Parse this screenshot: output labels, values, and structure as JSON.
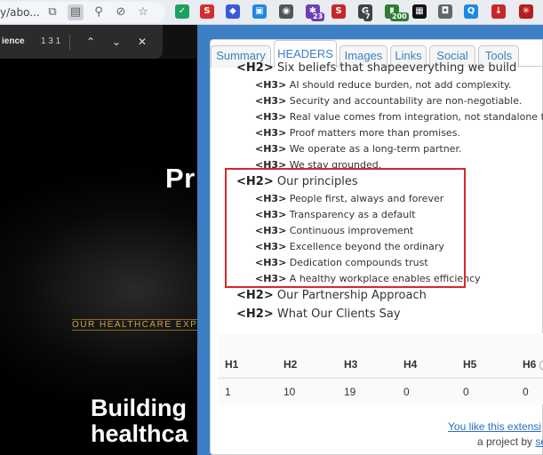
{
  "browser": {
    "url_fragment": "y/abo...",
    "extensions": [
      {
        "name": "shield-check-ext",
        "color": "#1aa260",
        "glyph": "✓"
      },
      {
        "name": "seo-ext",
        "color": "#d32f2f",
        "glyph": "S"
      },
      {
        "name": "tag-ext",
        "color": "#3a5bd9",
        "glyph": "◆"
      },
      {
        "name": "square-ext",
        "color": "#1e88e5",
        "glyph": "▣"
      },
      {
        "name": "location-ext",
        "color": "#555555",
        "glyph": "◉"
      },
      {
        "name": "puzzle-ext",
        "color": "#6a3fb5",
        "glyph": "✱",
        "badge": "23",
        "badge_color": "#6a3fb5"
      },
      {
        "name": "s-ext",
        "color": "#c62828",
        "glyph": "S"
      },
      {
        "name": "g-ext",
        "color": "#424242",
        "glyph": "G",
        "badge": "7",
        "badge_color": "#424242"
      },
      {
        "name": "chart-ext",
        "color": "#2e7d32",
        "glyph": "▮",
        "badge": "200",
        "badge_color": "#2e7d32"
      },
      {
        "name": "qr-ext",
        "color": "#111111",
        "glyph": "▦"
      },
      {
        "name": "camera-ext",
        "color": "#666666",
        "glyph": "◘"
      },
      {
        "name": "q-ext",
        "color": "#1e88e5",
        "glyph": "Q"
      },
      {
        "name": "down-ext",
        "color": "#c62828",
        "glyph": "↓"
      },
      {
        "name": "spider-ext",
        "color": "#b71c1c",
        "glyph": "✳"
      }
    ]
  },
  "findbar": {
    "query": "ience",
    "count": "1 3 1"
  },
  "page": {
    "hero_pr": "Pr",
    "hero_exp": "OUR HEALTHCARE EXPERIE",
    "hero_line1": "Building",
    "hero_line2": "healthca"
  },
  "popup": {
    "tabs": [
      "Summary",
      "HEADERS",
      "Images",
      "Links",
      "Social",
      "Tools"
    ],
    "active_tab": "HEADERS",
    "tree": [
      {
        "level": "H2",
        "tag": "<H2>",
        "text": "Six beliefs that shapeeverything we build"
      },
      {
        "level": "H3",
        "tag": "<H3>",
        "text": "AI should reduce burden, not add complexity."
      },
      {
        "level": "H3",
        "tag": "<H3>",
        "text": "Security and accountability are non-negotiable."
      },
      {
        "level": "H3",
        "tag": "<H3>",
        "text": "Real value comes from integration, not standalone tools."
      },
      {
        "level": "H3",
        "tag": "<H3>",
        "text": "Proof matters more than promises."
      },
      {
        "level": "H3",
        "tag": "<H3>",
        "text": "We operate as a long-term partner."
      },
      {
        "level": "H3",
        "tag": "<H3>",
        "text": "We stay grounded."
      },
      {
        "level": "H2",
        "tag": "<H2>",
        "text": "Our principles"
      },
      {
        "level": "H3",
        "tag": "<H3>",
        "text": "People first, always and forever"
      },
      {
        "level": "H3",
        "tag": "<H3>",
        "text": "Transparency as a default"
      },
      {
        "level": "H3",
        "tag": "<H3>",
        "text": "Continuous improvement"
      },
      {
        "level": "H3",
        "tag": "<H3>",
        "text": "Excellence beyond the ordinary"
      },
      {
        "level": "H3",
        "tag": "<H3>",
        "text": "Dedication compounds trust"
      },
      {
        "level": "H3",
        "tag": "<H3>",
        "text": "A healthy workplace enables efficiency"
      },
      {
        "level": "H2",
        "tag": "<H2>",
        "text": "Our Partnership Approach"
      },
      {
        "level": "H2",
        "tag": "<H2>",
        "text": "What Our Clients Say"
      }
    ],
    "stats": {
      "headers": [
        "H1",
        "H2",
        "H3",
        "H4",
        "H5",
        "H6"
      ],
      "values": [
        "1",
        "10",
        "19",
        "0",
        "0",
        "0"
      ]
    },
    "footer_link": "You like this extensi",
    "footer_prefix": "a project by ",
    "footer_author": "se"
  }
}
